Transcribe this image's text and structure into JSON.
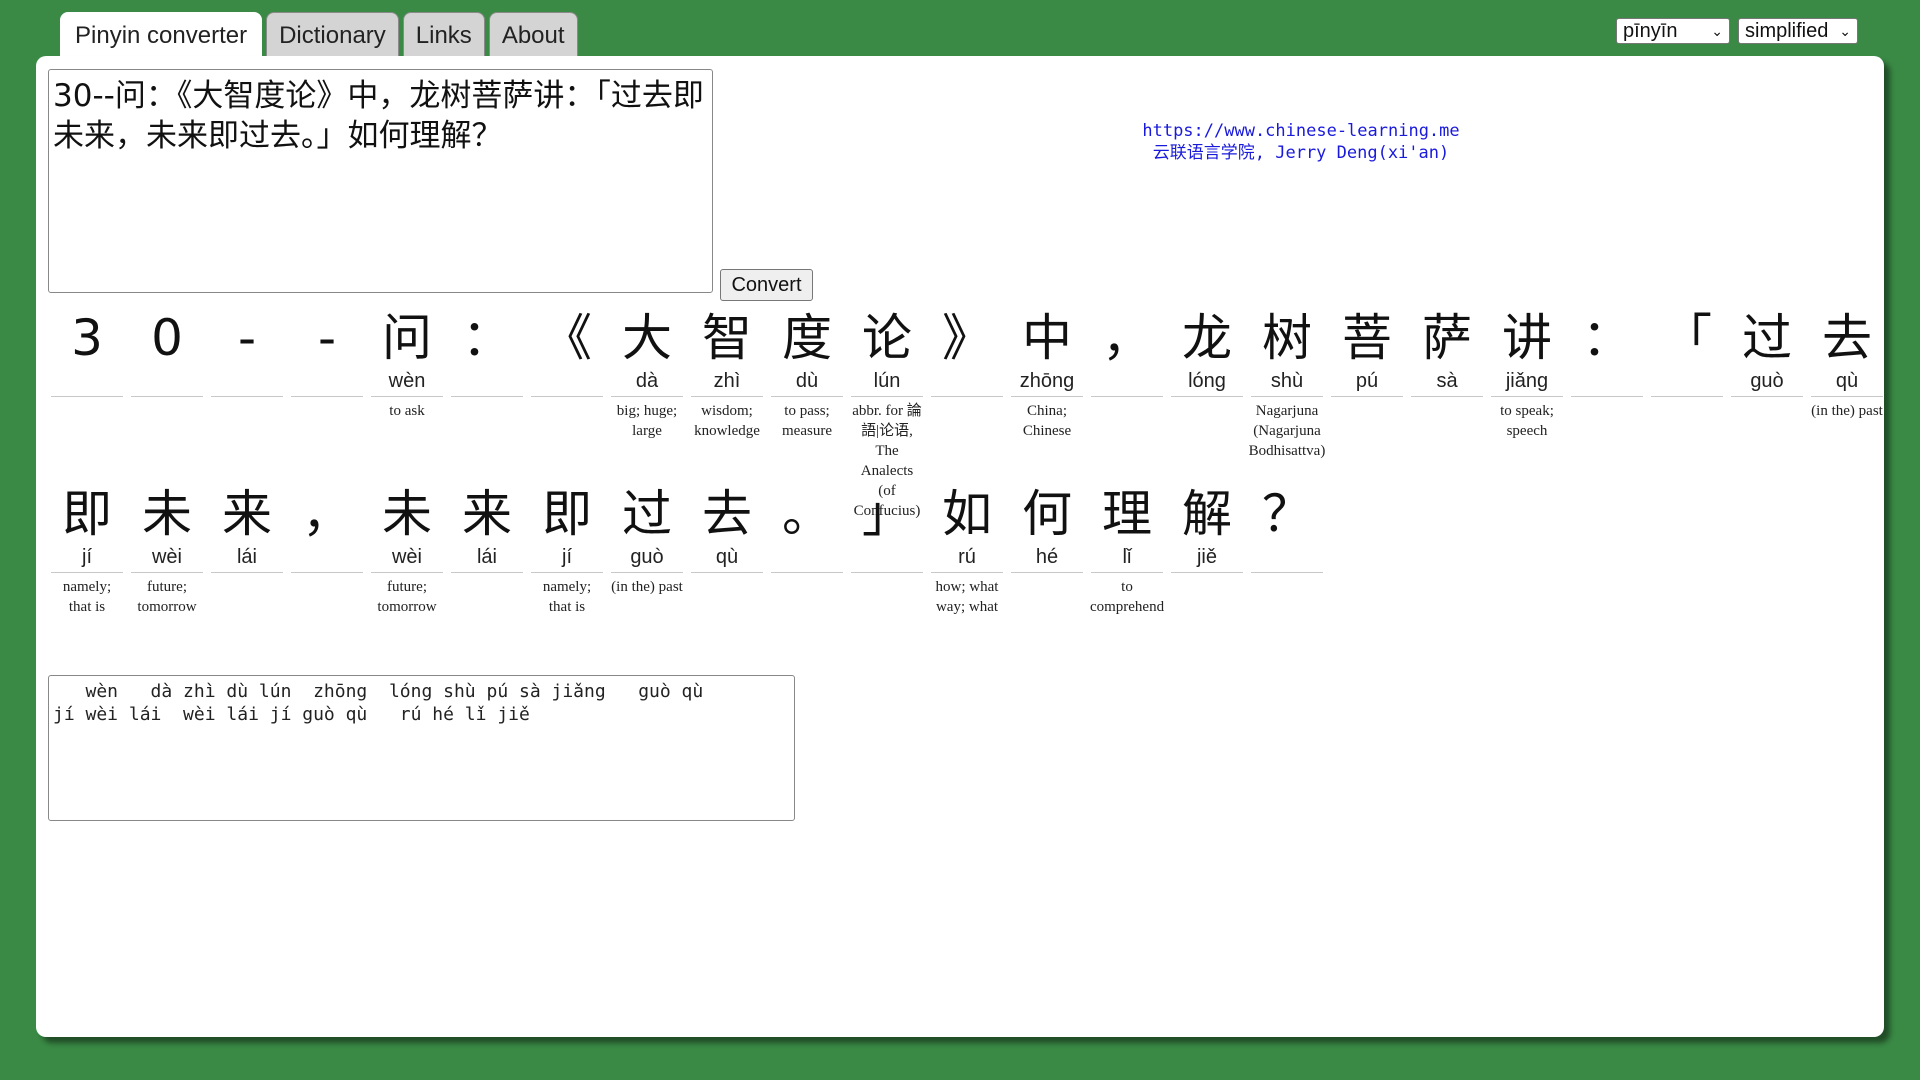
{
  "tabs": [
    "Pinyin converter",
    "Dictionary",
    "Links",
    "About"
  ],
  "prefs": {
    "tone_style": "pīnyīn",
    "script": "simplified"
  },
  "input": {
    "text": "30--问：《大智度论》中，龙树菩萨讲：「过去即未来，未来即过去。」如何理解？"
  },
  "convert_label": "Convert",
  "credit": {
    "url": "https://www.chinese-learning.me",
    "name": "云联语言学院, Jerry Deng(xi'an)"
  },
  "row1": [
    {
      "h": "3",
      "p": "",
      "d": ""
    },
    {
      "h": "0",
      "p": "",
      "d": ""
    },
    {
      "h": "-",
      "p": "",
      "d": ""
    },
    {
      "h": "-",
      "p": "",
      "d": ""
    },
    {
      "h": "问",
      "p": "wèn",
      "d": "to ask"
    },
    {
      "h": "：",
      "p": "",
      "d": ""
    },
    {
      "h": "《",
      "p": "",
      "d": ""
    },
    {
      "h": "大",
      "p": "dà",
      "d": "big; huge; large"
    },
    {
      "h": "智",
      "p": "zhì",
      "d": "wisdom; knowledge"
    },
    {
      "h": "度",
      "p": "dù",
      "d": "to pass; measure"
    },
    {
      "h": "论",
      "p": "lún",
      "d": "abbr. for 論語|论语, The Analects (of Confucius)"
    },
    {
      "h": "》",
      "p": "",
      "d": ""
    },
    {
      "h": "中",
      "p": "zhōng",
      "d": "China; Chinese"
    },
    {
      "h": "，",
      "p": "",
      "d": ""
    },
    {
      "h": "龙",
      "p": "lóng",
      "d": ""
    },
    {
      "h": "树",
      "p": "shù",
      "d": "Nagarjuna (Nagarjuna Bodhisattva)"
    },
    {
      "h": "菩",
      "p": "pú",
      "d": ""
    },
    {
      "h": "萨",
      "p": "sà",
      "d": ""
    },
    {
      "h": "讲",
      "p": "jiǎng",
      "d": "to speak; speech"
    },
    {
      "h": "：",
      "p": "",
      "d": ""
    },
    {
      "h": "「",
      "p": "",
      "d": ""
    },
    {
      "h": "过",
      "p": "guò",
      "d": ""
    },
    {
      "h": "去",
      "p": "qù",
      "d": "(in the) past"
    }
  ],
  "row2": [
    {
      "h": "即",
      "p": "jí",
      "d": "namely; that is"
    },
    {
      "h": "未",
      "p": "wèi",
      "d": "future; tomorrow"
    },
    {
      "h": "来",
      "p": "lái",
      "d": ""
    },
    {
      "h": "，",
      "p": "",
      "d": ""
    },
    {
      "h": "未",
      "p": "wèi",
      "d": "future; tomorrow"
    },
    {
      "h": "来",
      "p": "lái",
      "d": ""
    },
    {
      "h": "即",
      "p": "jí",
      "d": "namely; that is"
    },
    {
      "h": "过",
      "p": "guò",
      "d": "(in the) past"
    },
    {
      "h": "去",
      "p": "qù",
      "d": ""
    },
    {
      "h": "。",
      "p": "",
      "d": ""
    },
    {
      "h": "」",
      "p": "",
      "d": ""
    },
    {
      "h": "如",
      "p": "rú",
      "d": "how; what way; what"
    },
    {
      "h": "何",
      "p": "hé",
      "d": ""
    },
    {
      "h": "理",
      "p": "lǐ",
      "d": "to comprehend"
    },
    {
      "h": "解",
      "p": "jiě",
      "d": ""
    },
    {
      "h": "？",
      "p": "",
      "d": ""
    }
  ],
  "pinyin_output": "   wèn   dà zhì dù lún  zhōng  lóng shù pú sà jiǎng   guò qù\njí wèi lái  wèi lái jí guò qù   rú hé lǐ jiě"
}
